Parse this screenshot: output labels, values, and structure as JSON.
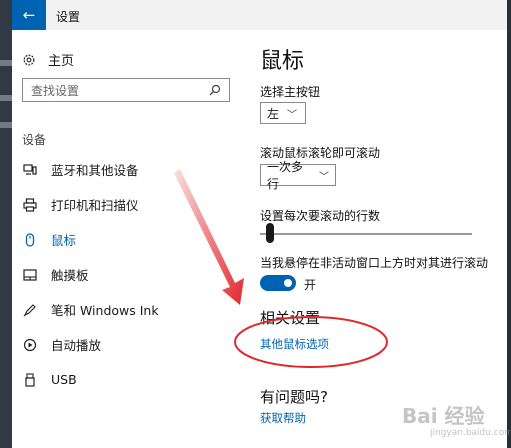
{
  "window": {
    "title": "设置",
    "back_icon": "←"
  },
  "sidebar": {
    "home_label": "主页",
    "search_placeholder": "查找设置",
    "section_label": "设备",
    "items": [
      {
        "label": "蓝牙和其他设备",
        "icon": "bluetooth-devices-icon",
        "active": false
      },
      {
        "label": "打印机和扫描仪",
        "icon": "printer-icon",
        "active": false
      },
      {
        "label": "鼠标",
        "icon": "mouse-icon",
        "active": true
      },
      {
        "label": "触摸板",
        "icon": "touchpad-icon",
        "active": false
      },
      {
        "label": "笔和 Windows Ink",
        "icon": "pen-icon",
        "active": false
      },
      {
        "label": "自动播放",
        "icon": "autoplay-icon",
        "active": false
      },
      {
        "label": "USB",
        "icon": "usb-icon",
        "active": false
      }
    ]
  },
  "main": {
    "title": "鼠标",
    "primary_button_label": "选择主按钮",
    "primary_button_value": "左",
    "scroll_label": "滚动鼠标滚轮即可滚动",
    "scroll_value": "一次多行",
    "lines_label": "设置每次要滚动的行数",
    "lines_slider_fraction": 0.03,
    "inactive_scroll_label": "当我悬停在非活动窗口上方时对其进行滚动",
    "inactive_scroll_state": "开",
    "related_title": "相关设置",
    "related_link": "其他鼠标选项",
    "question_title": "有问题吗?",
    "help_link": "获取帮助"
  },
  "watermark": {
    "text": "Bai 经验",
    "sub": "jingyan.baidu.com"
  },
  "colors": {
    "accent": "#0063b1",
    "annotation_red": "#e0292f"
  }
}
